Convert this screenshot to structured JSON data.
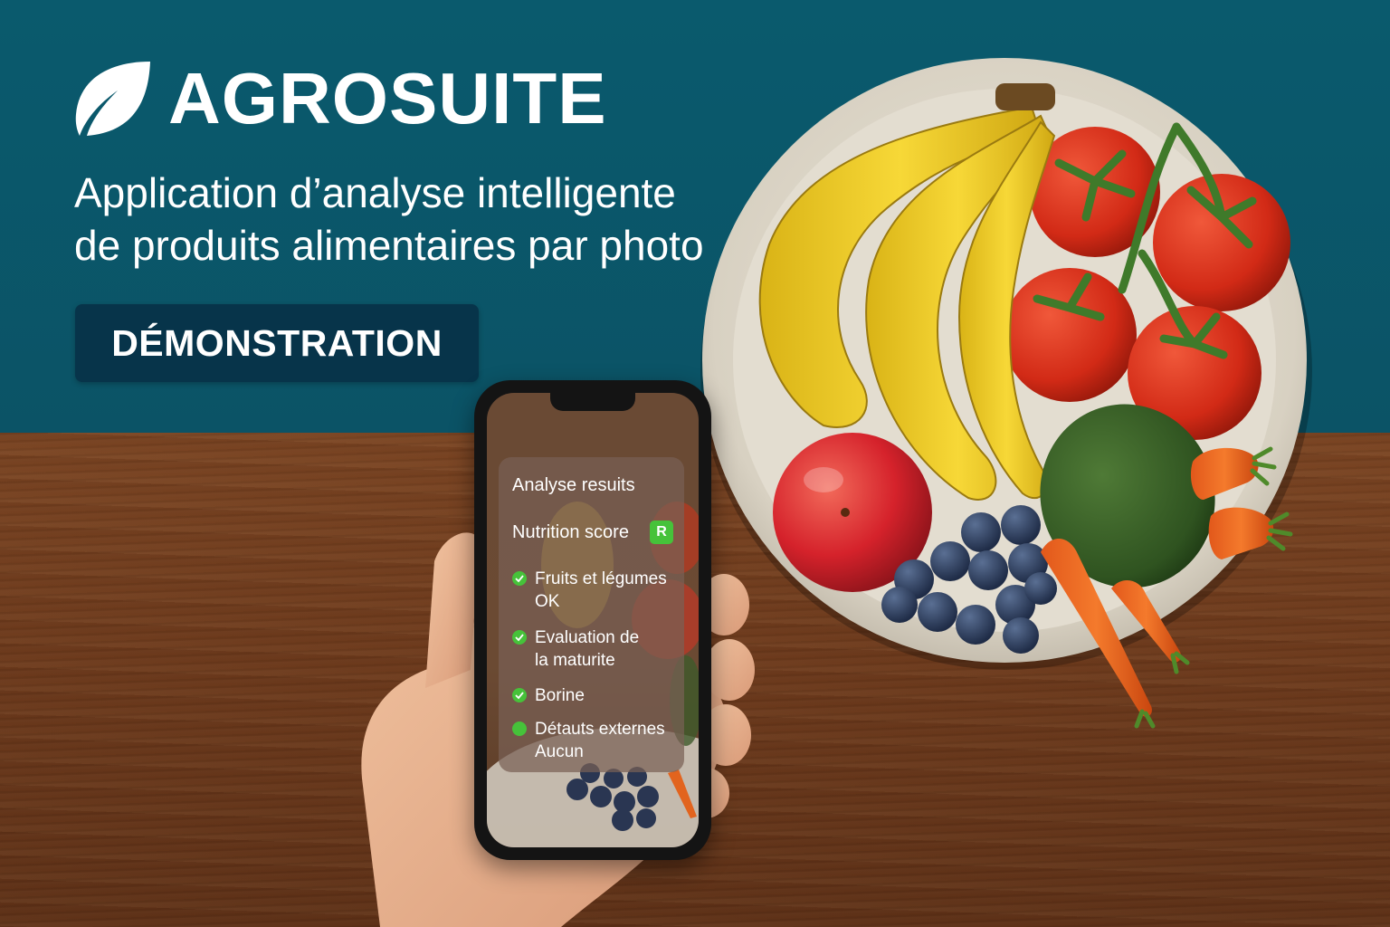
{
  "brand": {
    "name": "AGROSUITE",
    "logo_icon": "leaf-icon",
    "color": "#ffffff"
  },
  "tagline": {
    "line1": "Application d’analyse intelligente",
    "line2": "de produits alimentaires par photo"
  },
  "cta": {
    "label": "DÉMONSTRATION",
    "color": "#07344a"
  },
  "phone_app": {
    "title": "Analyse resuits",
    "nutrition": {
      "label": "Nutrition score",
      "badge": "R",
      "badge_color": "#46c23a"
    },
    "checks": [
      {
        "line1": "Fruits et légumes",
        "line2": "OK",
        "icon": "check-circle-icon"
      },
      {
        "line1": "Evaluation de",
        "line2": "la maturite",
        "icon": "check-circle-icon"
      },
      {
        "line1": "Borine",
        "line2": "",
        "icon": "check-circle-icon"
      },
      {
        "line1": "Détauts externes",
        "line2": "Aucun",
        "icon": "status-dot-icon"
      }
    ]
  },
  "colors": {
    "background": "#0b5668",
    "table": "#6d3a1c"
  }
}
